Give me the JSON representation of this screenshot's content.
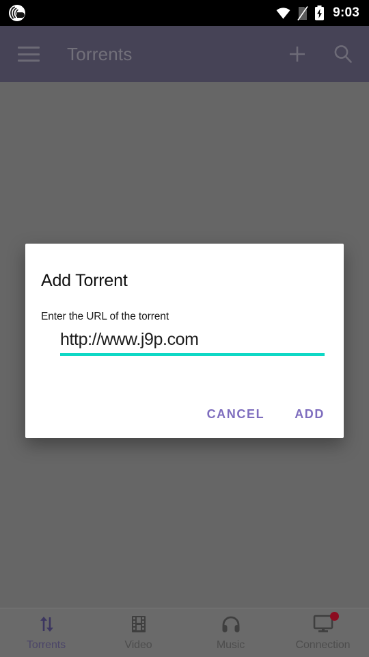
{
  "status_bar": {
    "app_icon": "bittorrent-logo-icon",
    "icons": [
      "wifi-icon",
      "no-sim-icon",
      "battery-charging-icon"
    ],
    "clock": "9:03"
  },
  "app_bar": {
    "menu_icon": "hamburger-menu-icon",
    "title": "Torrents",
    "actions": [
      {
        "name": "add-torrent-button",
        "icon": "plus-icon"
      },
      {
        "name": "search-button",
        "icon": "search-icon"
      }
    ]
  },
  "dialog": {
    "title": "Add Torrent",
    "message": "Enter the URL of the torrent",
    "input": {
      "value": "http://www.j9p.com",
      "placeholder": "http://",
      "underline_color": "#0ed8c5"
    },
    "cancel_label": "CANCEL",
    "add_label": "ADD",
    "button_color": "#7e6dbe"
  },
  "bottom_nav": {
    "items": [
      {
        "label": "Torrents",
        "icon": "transfer-arrows-icon",
        "active": true,
        "badge": false
      },
      {
        "label": "Video",
        "icon": "film-strip-icon",
        "active": false,
        "badge": false
      },
      {
        "label": "Music",
        "icon": "headphones-icon",
        "active": false,
        "badge": false
      },
      {
        "label": "Connection",
        "icon": "monitor-icon",
        "active": false,
        "badge": true
      }
    ]
  },
  "colors": {
    "app_bar": "#2f2a4a",
    "scrim": "#666666",
    "accent_teal": "#0ed8c5",
    "accent_purple": "#7e6dbe",
    "badge_red": "#8c0b20"
  }
}
